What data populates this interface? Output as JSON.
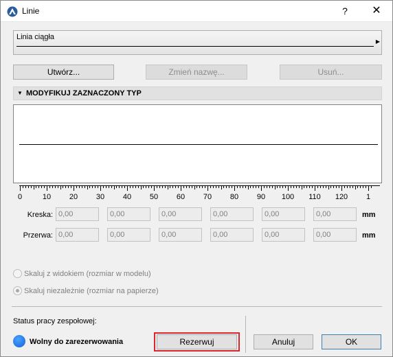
{
  "window": {
    "title": "Linie",
    "help": "?",
    "close": "✕"
  },
  "linetype": {
    "selected": "Linia ciągła"
  },
  "buttons": {
    "create": "Utwórz...",
    "rename": "Zmień nazwę...",
    "delete": "Usuń..."
  },
  "section": {
    "title": "MODYFIKUJ ZAZNACZONY TYP"
  },
  "ruler": {
    "labels": [
      "0",
      "10",
      "20",
      "30",
      "40",
      "50",
      "60",
      "70",
      "80",
      "90",
      "100",
      "110",
      "120",
      "1"
    ]
  },
  "dash": {
    "label": "Kreska:",
    "values": [
      "0,00",
      "0,00",
      "0,00",
      "0,00",
      "0,00",
      "0,00"
    ],
    "unit": "mm"
  },
  "gap": {
    "label": "Przerwa:",
    "values": [
      "0,00",
      "0,00",
      "0,00",
      "0,00",
      "0,00",
      "0,00"
    ],
    "unit": "mm"
  },
  "scaling": {
    "option1": "Skaluj z widokiem (rozmiar w modelu)",
    "option2": "Skaluj niezależnie (rozmiar na papierze)",
    "selected": "option2"
  },
  "teamwork": {
    "status_label": "Status pracy zespołowej:",
    "status_text": "Wolny do zarezerwowania",
    "status_color": "#1e74e8",
    "reserve": "Rezerwuj"
  },
  "footer": {
    "cancel": "Anuluj",
    "ok": "OK"
  },
  "colors": {
    "highlight": "#d9262c"
  }
}
